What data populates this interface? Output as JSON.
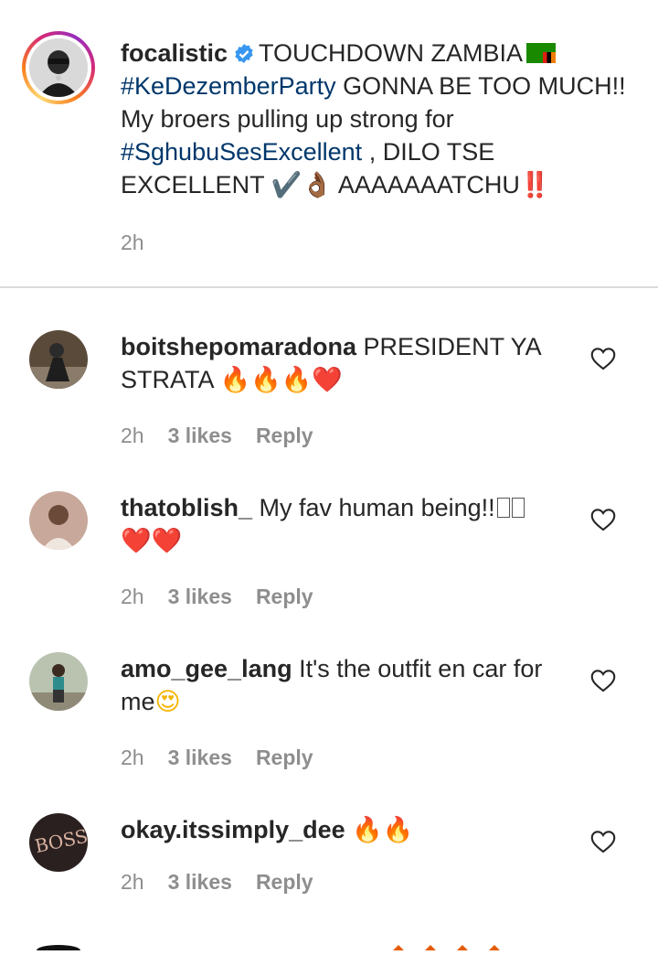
{
  "post": {
    "username": "focalistic",
    "caption_line1": "TOUCHDOWN ZAMBIA",
    "hashtag1": "#KeDezemberParty",
    "caption_line2": " GONNA BE TOO MUCH!! My broers pulling up strong for ",
    "hashtag2": "#SghubuSesExcellent",
    "caption_line3": " , DILO TSE EXCELLENT ",
    "emoji_check": "✔️",
    "emoji_ok": "👌🏾",
    "caption_line4": " AAAAAAATCHU",
    "emoji_bang": "‼️",
    "time": "2h"
  },
  "comments": [
    {
      "username": "boitshepomaradona",
      "text": " PRESIDENT YA STRATA ",
      "emoji": "🔥🔥🔥❤️",
      "time": "2h",
      "likes": "3 likes",
      "reply": "Reply"
    },
    {
      "username": "thatoblish_",
      "text": " My fav human being!!",
      "emoji": "❤️❤️",
      "time": "2h",
      "likes": "3 likes",
      "reply": "Reply"
    },
    {
      "username": "amo_gee_lang",
      "text": " It's the outfit en car for me",
      "emoji": "😍",
      "time": "2h",
      "likes": "3 likes",
      "reply": "Reply"
    },
    {
      "username": "okay.itssimply_dee",
      "text": " ",
      "emoji": "🔥🔥",
      "time": "2h",
      "likes": "3 likes",
      "reply": "Reply"
    }
  ],
  "colors": {
    "text": "#262626",
    "hashtag": "#00376b",
    "meta": "#8e8e8e",
    "verified": "#3897f0"
  }
}
